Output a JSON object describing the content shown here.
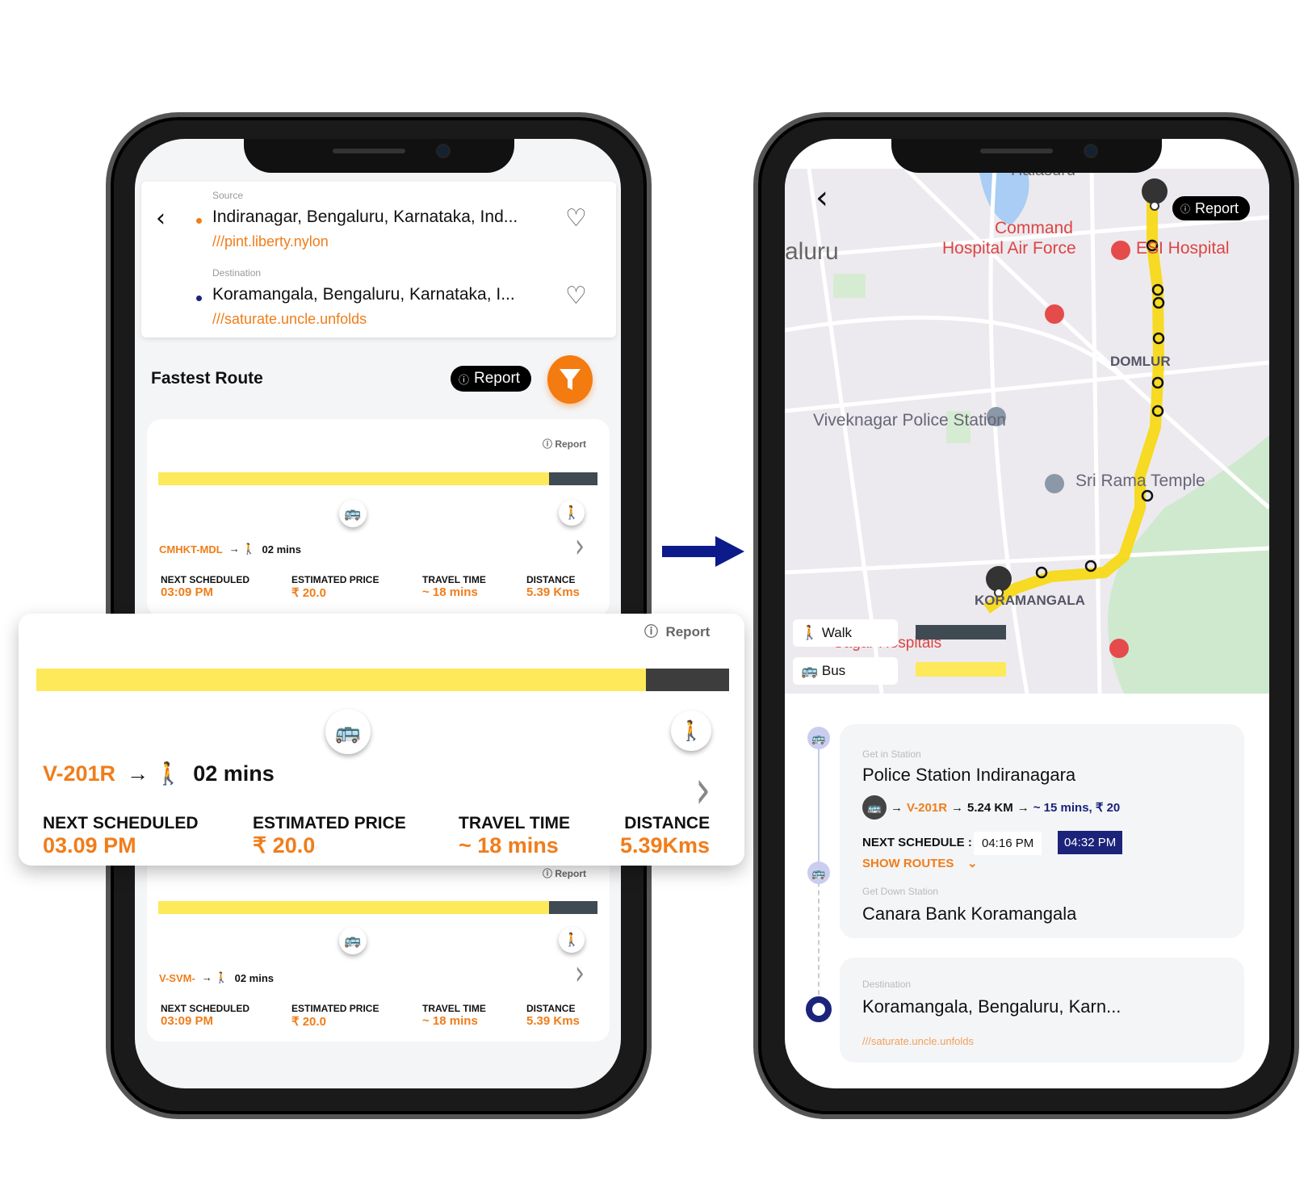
{
  "left_phone": {
    "source": {
      "label": "Source",
      "name": "Indiranagar, Bengaluru, Karnataka, Ind...",
      "code": "///pint.liberty.nylon"
    },
    "destination": {
      "label": "Destination",
      "name": "Koramangala, Bengaluru, Karnataka, I...",
      "code": "///saturate.uncle.unfolds"
    },
    "section_title": "Fastest Route",
    "report_label": "Report",
    "routes": [
      {
        "report": "Report",
        "bus_share": 0.89,
        "route": "CMHKT-MDL",
        "walk": "02 mins",
        "stats": [
          {
            "h": "NEXT SCHEDULED",
            "v": "03:09 PM"
          },
          {
            "h": "ESTIMATED PRICE",
            "v": "₹ 20.0"
          },
          {
            "h": "TRAVEL TIME",
            "v": "~ 18 mins"
          },
          {
            "h": "DISTANCE",
            "v": "5.39 Kms"
          }
        ]
      },
      {
        "report": "Report",
        "bus_share": 0.89,
        "route": "V-SVM-",
        "walk": "02 mins",
        "stats": [
          {
            "h": "NEXT SCHEDULED",
            "v": "03:09 PM"
          },
          {
            "h": "ESTIMATED PRICE",
            "v": "₹ 20.0"
          },
          {
            "h": "TRAVEL TIME",
            "v": "~ 18 mins"
          },
          {
            "h": "DISTANCE",
            "v": "5.39 Kms"
          }
        ]
      }
    ]
  },
  "zoom_card": {
    "report": "Report",
    "bus_share": 0.88,
    "route": "V-201R",
    "walk": "02 mins",
    "stats": [
      {
        "h": "NEXT SCHEDULED",
        "v": "03.09 PM"
      },
      {
        "h": "ESTIMATED PRICE",
        "v": "₹ 20.0"
      },
      {
        "h": "TRAVEL TIME",
        "v": "~ 18 mins"
      },
      {
        "h": "DISTANCE",
        "v": "5.39Kms"
      }
    ]
  },
  "right_phone": {
    "report_label": "Report",
    "map_labels": {
      "area": "aluru",
      "top": "Halasuru",
      "command": "Command",
      "command2": "Hospital Air Force",
      "esi": "ESI Hospital",
      "domlur": "DOMLUR",
      "police": "Viveknagar Police Station",
      "temple": "Sri Rama Temple",
      "kora": "KORAMANGALA",
      "sagar": "Sagar Hospitals"
    },
    "legend": [
      {
        "label": "Walk",
        "color": "#3f4a52"
      },
      {
        "label": "Bus",
        "color": "#fde95a"
      }
    ],
    "get_in": {
      "label": "Get in Station",
      "name": "Police Station Indiranagara",
      "route": "V-201R",
      "distance": "5.24 KM",
      "eta": "~ 15 mins, ₹ 20",
      "schedule_label": "NEXT SCHEDULE :",
      "times": [
        "04:16 PM",
        "04:32 PM"
      ],
      "show_routes": "SHOW ROUTES"
    },
    "get_down": {
      "label": "Get Down Station",
      "name": "Canara Bank Koramangala"
    },
    "destination": {
      "label": "Destination",
      "name": "Koramangala, Bengaluru, Karn...",
      "code": "///saturate.uncle.unfolds"
    }
  },
  "colors": {
    "accent": "#f07d1a",
    "navy": "#1b237a",
    "bus": "#fde95a",
    "walk": "#3f4a52",
    "arrow": "#0c1a8a"
  }
}
